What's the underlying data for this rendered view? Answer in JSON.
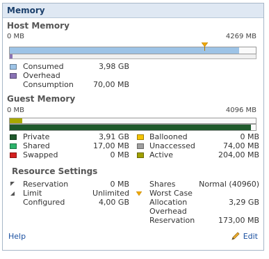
{
  "panel": {
    "title": "Memory"
  },
  "host": {
    "title": "Host Memory",
    "scale_min": "0 MB",
    "scale_max": "4269 MB",
    "consumed_fraction": 0.932,
    "marker_fraction": 0.795,
    "legend": [
      {
        "label": "Consumed",
        "value": "3,98 GB",
        "color": "#9dc3e6"
      },
      {
        "label": "Overhead",
        "value": "",
        "color": "#8a73b5"
      },
      {
        "label": "Consumption",
        "value": "70,00 MB",
        "color": ""
      }
    ]
  },
  "guest": {
    "title": "Guest Memory",
    "scale_min": "0 MB",
    "scale_max": "4096 MB",
    "active_fraction": 0.05,
    "private_fraction": 0.98,
    "legend_left": [
      {
        "label": "Private",
        "value": "3,91 GB",
        "color": "#1f5a2c"
      },
      {
        "label": "Shared",
        "value": "17,00 MB",
        "color": "#2db36b"
      },
      {
        "label": "Swapped",
        "value": "0 MB",
        "color": "#d42020"
      }
    ],
    "legend_right": [
      {
        "label": "Ballooned",
        "value": "0 MB",
        "color": "#f5c400"
      },
      {
        "label": "Unaccessed",
        "value": "74,00 MB",
        "color": "#a0a0a0"
      },
      {
        "label": "Active",
        "value": "204,00 MB",
        "color": "#a0a000"
      }
    ]
  },
  "resources": {
    "title": "Resource Settings",
    "reservation": {
      "label": "Reservation",
      "value": "0 MB"
    },
    "limit": {
      "label": "Limit",
      "value": "Unlimited"
    },
    "configured": {
      "label": "Configured",
      "value": "4,00 GB"
    },
    "shares": {
      "label": "Shares",
      "value": "Normal (40960)"
    },
    "worst_case": {
      "label1": "Worst Case",
      "label2": "Allocation",
      "value": "3,29 GB"
    },
    "overhead_res": {
      "label1": "Overhead",
      "label2": "Reservation",
      "value": "173,00 MB"
    }
  },
  "footer": {
    "help": "Help",
    "edit": "Edit"
  }
}
